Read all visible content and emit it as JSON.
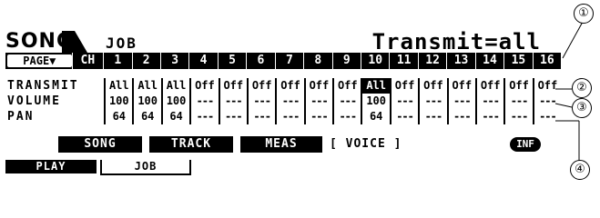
{
  "header": {
    "mode": "SONG",
    "sub_mode": "JOB",
    "parameter_title": "Transmit=all"
  },
  "channel_bar": {
    "page_label": "PAGE▼",
    "ch_label": "CH",
    "channels": [
      "1",
      "2",
      "3",
      "4",
      "5",
      "6",
      "7",
      "8",
      "9",
      "10",
      "11",
      "12",
      "13",
      "14",
      "15",
      "16"
    ]
  },
  "rows": [
    {
      "label": "TRANSMIT",
      "values": [
        "All",
        "All",
        "All",
        "Off",
        "Off",
        "Off",
        "Off",
        "Off",
        "Off",
        "All",
        "Off",
        "Off",
        "Off",
        "Off",
        "Off",
        "Off"
      ],
      "highlight_index": 9
    },
    {
      "label": "VOLUME",
      "values": [
        "100",
        "100",
        "100",
        "---",
        "---",
        "---",
        "---",
        "---",
        "---",
        "100",
        "---",
        "---",
        "---",
        "---",
        "---",
        "---"
      ]
    },
    {
      "label": "PAN",
      "values": [
        "64",
        "64",
        "64",
        "---",
        "---",
        "---",
        "---",
        "---",
        "---",
        "64",
        "---",
        "---",
        "---",
        "---",
        "---",
        "---"
      ]
    }
  ],
  "soft_buttons": {
    "song": "SONG",
    "track": "TRACK",
    "meas": "MEAS",
    "voice": "[ VOICE ]",
    "inf": "INF"
  },
  "tabs": {
    "play": "PLAY",
    "job": "JOB"
  },
  "callouts": [
    "①",
    "②",
    "③",
    "④"
  ]
}
